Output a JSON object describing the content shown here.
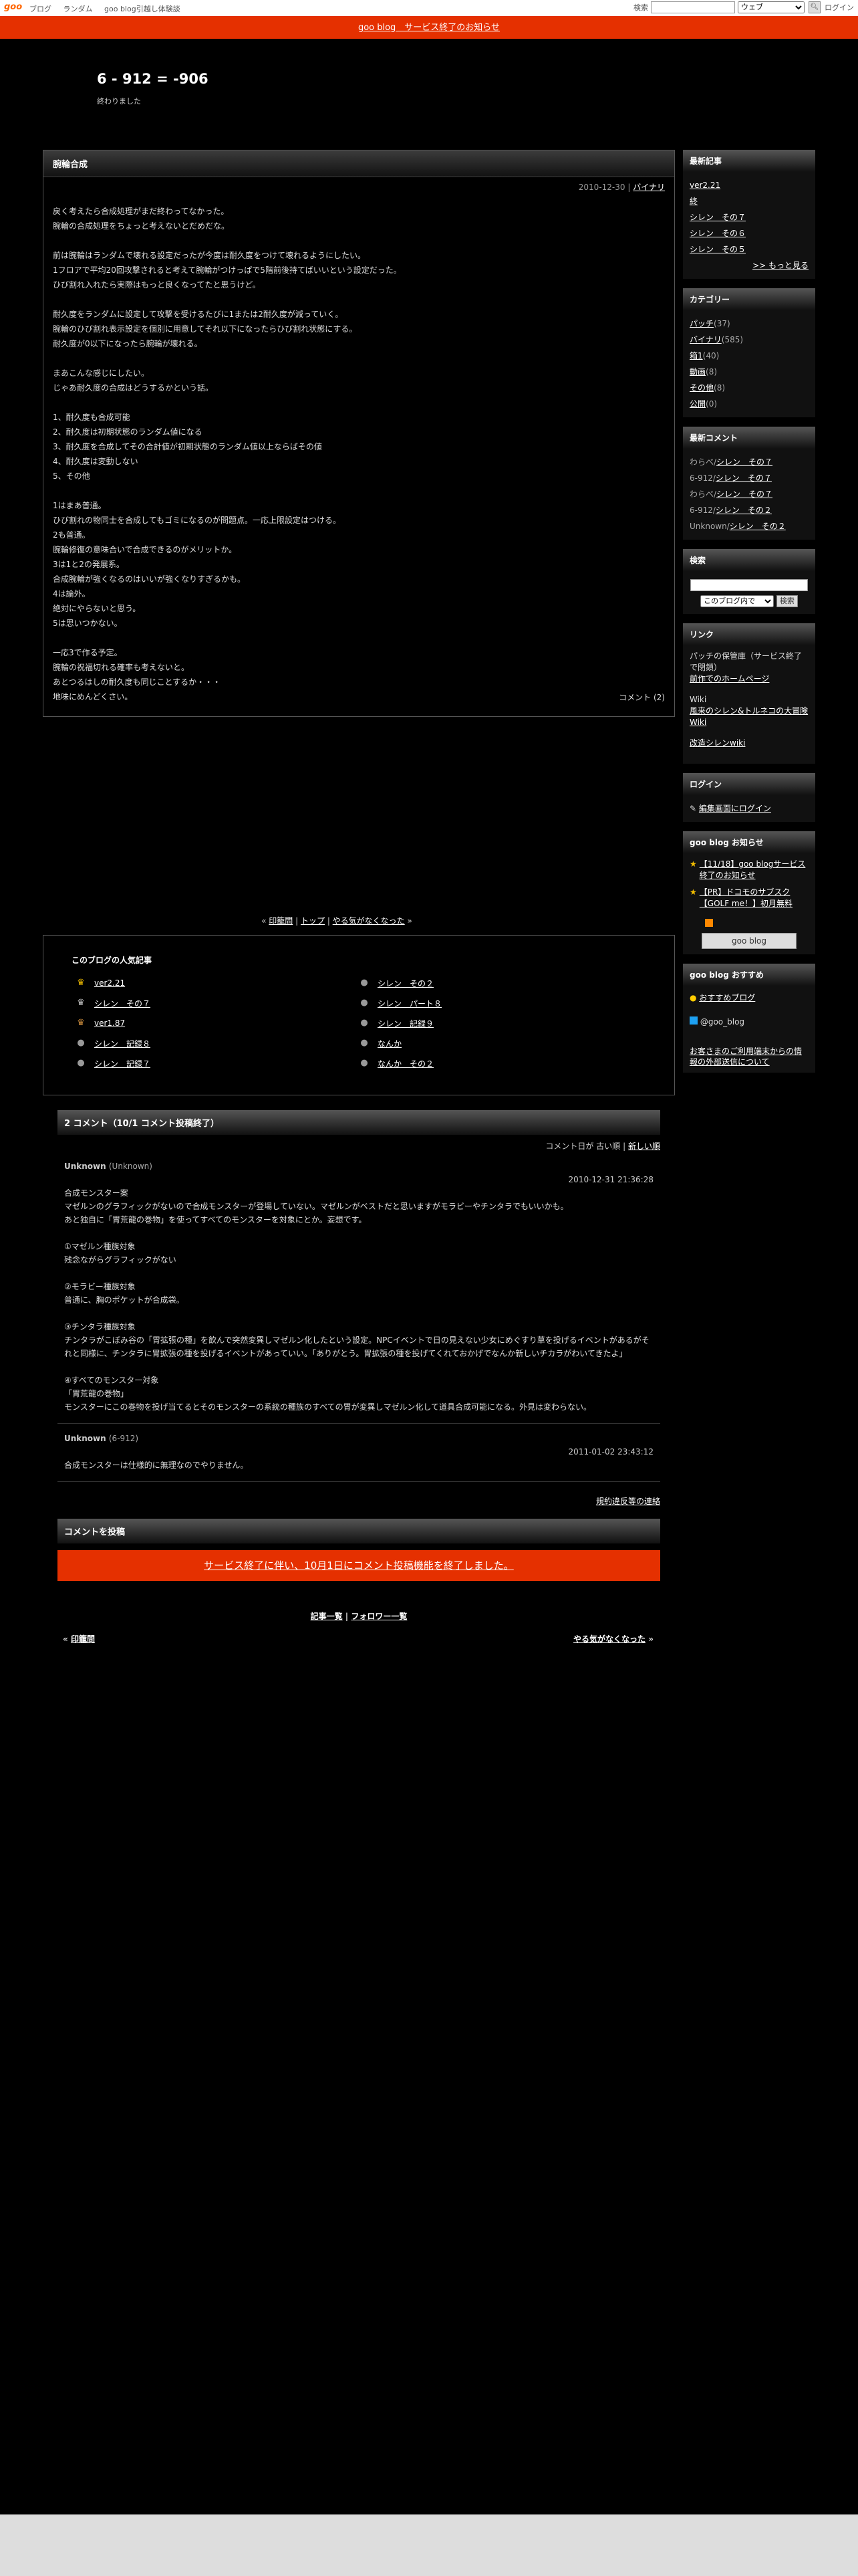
{
  "topbar": {
    "logo": "goo",
    "nav": [
      "ブログ",
      "ランダム",
      "goo blog引越し体験談"
    ],
    "search_label": "検索",
    "search_placeholder": "",
    "search_scope": "ウェブ",
    "login": "ログイン"
  },
  "notice": "goo blog　サービス終了のお知らせ",
  "blog": {
    "title": "6 - 912 = -906",
    "subtitle": "終わりました"
  },
  "article": {
    "title": "腕輪合成",
    "date": "2010-12-30",
    "sep": "|",
    "category": "バイナリ",
    "paragraphs": [
      [
        "戻く考えたら合成処理がまだ終わってなかった。",
        "腕輪の合成処理をちょっと考えないとだめだな。"
      ],
      [
        "前は腕輪はランダムで壊れる設定だったが今度は耐久度をつけて壊れるようにしたい。",
        "1フロアで平均20回攻撃されると考えて腕輪がつけっぱで5階前後持てばいいという設定だった。",
        "ひび割れ入れたら実際はもっと良くなってたと思うけど。"
      ],
      [
        "耐久度をランダムに設定して攻撃を受けるたびに1または2耐久度が減っていく。",
        "腕輪のひび割れ表示設定を個別に用意してそれ以下になったらひび割れ状態にする。",
        "耐久度が0以下になったら腕輪が壊れる。"
      ],
      [
        "まあこんな感じにしたい。",
        "じゃあ耐久度の合成はどうするかという話。"
      ],
      [
        "1、耐久度も合成可能",
        "2、耐久度は初期状態のランダム値になる",
        "3、耐久度を合成してその合計値が初期状態のランダム値以上ならばその値",
        "4、耐久度は変動しない",
        "5、その他"
      ],
      [
        "1はまあ普通。",
        "ひび割れの物同士を合成してもゴミになるのが問題点。一応上限設定はつける。",
        "2も普通。",
        "腕輪修復の意味合いで合成できるのがメリットか。",
        "3は1と2の発展系。",
        "合成腕輪が強くなるのはいいが強くなりすぎるかも。",
        "4は論外。",
        "絶対にやらないと思う。",
        "5は思いつかない。"
      ],
      [
        "一応3で作る予定。",
        "腕輪の祝福切れる確率も考えないと。",
        "あとつるはしの耐久度も同じことするか・・・",
        "地味にめんどくさい。"
      ]
    ],
    "comment_count": "コメント (2)"
  },
  "pager": {
    "prev": "印籠問",
    "top": "トップ",
    "next": "やる気がなくなった"
  },
  "popular": {
    "title": "このブログの人気記事",
    "left": [
      {
        "icon": "gold-crown-icon",
        "label": "ver2.21"
      },
      {
        "icon": "silver-crown-icon",
        "label": "シレン　その７"
      },
      {
        "icon": "bronze-crown-icon",
        "label": "ver1.87"
      },
      {
        "icon": "gray-circle-icon",
        "label": "シレン　記録８"
      },
      {
        "icon": "gray-circle-icon",
        "label": "シレン　記録７"
      }
    ],
    "right": [
      {
        "icon": "gray-circle-icon",
        "label": "シレン　その２"
      },
      {
        "icon": "gray-circle-icon",
        "label": "シレン　パート８"
      },
      {
        "icon": "gray-circle-icon",
        "label": "シレン　記録９"
      },
      {
        "icon": "gray-circle-icon",
        "label": "なんか"
      },
      {
        "icon": "gray-circle-icon",
        "label": "なんか　その２"
      }
    ]
  },
  "comments": {
    "header": "2 コメント（10/1 コメント投稿終了）",
    "sort_label": "コメント日が",
    "sort_old": "古い順",
    "sort_sep": "|",
    "sort_new": "新しい順",
    "items": [
      {
        "author": "Unknown",
        "author_id": "(Unknown)",
        "date": "2010-12-31 21:36:28",
        "text": "合成モンスター案\nマゼルンのグラフィックがないので合成モンスターが登場していない。マゼルンがベストだと思いますがモラビーやチンタラでもいいかも。\nあと独自に「胃荒龍の巻物」を使ってすべてのモンスターを対象にとか。妄想です。\n\n①マゼルン種族対象\n残念ながらグラフィックがない\n\n②モラビー種族対象\n普通に、胸のポケットが合成袋。\n\n③チンタラ種族対象\nチンタラがこぼみ谷の「胃拡張の種」を飲んで突然変異しマゼルン化したという設定。NPCイベントで日の見えない少女にめぐすり草を投げるイベントがあるがそれと同様に、チンタラに胃拡張の種を投げるイベントがあっていい。「ありがとう。胃拡張の種を投げてくれておかげでなんか新しいチカラがわいてきたよ」\n\n④すべてのモンスター対象\n「胃荒龍の巻物」\nモンスターにこの巻物を投げ当てるとそのモンスターの系統の種族のすべての胃が変異しマゼルン化して道具合成可能になる。外見は変わらない。"
      },
      {
        "author": "Unknown",
        "author_id": "(6-912)",
        "date": "2011-01-02 23:43:12",
        "text": "合成モンスターは仕様的に無理なのでやりません。"
      }
    ],
    "tos": "規約違反等の連絡",
    "post_header": "コメントを投稿",
    "post_notice": "サービス終了に伴い、10月1日にコメント投稿機能を終了しました。"
  },
  "bottom": {
    "list": "記事一覧",
    "sep": "|",
    "follower": "フォロワー一覧",
    "prev": "印籠問",
    "next": "やる気がなくなった"
  },
  "sidebar": {
    "recent_title": "最新記事",
    "recent": [
      "ver2.21",
      "終",
      "シレン　その７",
      "シレン　その６",
      "シレン　その５"
    ],
    "more": ">> もっと見る",
    "category_title": "カテゴリー",
    "categories": [
      {
        "name": "パッチ",
        "count": "(37)"
      },
      {
        "name": "バイナリ",
        "count": "(585)"
      },
      {
        "name": "箱1",
        "count": "(40)"
      },
      {
        "name": "動画",
        "count": "(8)"
      },
      {
        "name": "その他",
        "count": "(8)"
      },
      {
        "name": "公開",
        "count": "(0)"
      }
    ],
    "comments_title": "最新コメント",
    "latest_comments": [
      {
        "who": "わらべ/",
        "post": "シレン　その７"
      },
      {
        "who": "6-912/",
        "post": "シレン　その７"
      },
      {
        "who": "わらべ/",
        "post": "シレン　その７"
      },
      {
        "who": "6-912/",
        "post": "シレン　その２"
      },
      {
        "who": "Unknown/",
        "post": "シレン　その２"
      }
    ],
    "search_title": "検索",
    "search_scope": "このブログ内で",
    "search_button": "検索",
    "link_title": "リンク",
    "links": [
      {
        "plain": "パッチの保管庫（サービス終了で閉鎖）",
        "link": "前作でのホームページ"
      },
      {
        "plain": "Wiki",
        "link": "風来のシレン&トルネコの大冒険 Wiki"
      },
      {
        "plain": "",
        "link": "改造シレンwiki"
      }
    ],
    "login_title": "ログイン",
    "login_link": "編集画面にログイン",
    "notice_title": "goo blog お知らせ",
    "notices": [
      "【11/18】goo blogサービス終了のお知らせ",
      "【PR】ドコモのサブスク【GOLF me！】初月無料"
    ],
    "gooblog_button": "goo blog",
    "recommend_title": "goo blog おすすめ",
    "recommend_link": "おすすめブログ",
    "twitter": "@goo_blog",
    "external_notice": "お客さまのご利用端末からの情報の外部送信について"
  },
  "colors": {
    "accent": "#e53000",
    "background": "#000000",
    "crown_gold": "#f6c000"
  }
}
